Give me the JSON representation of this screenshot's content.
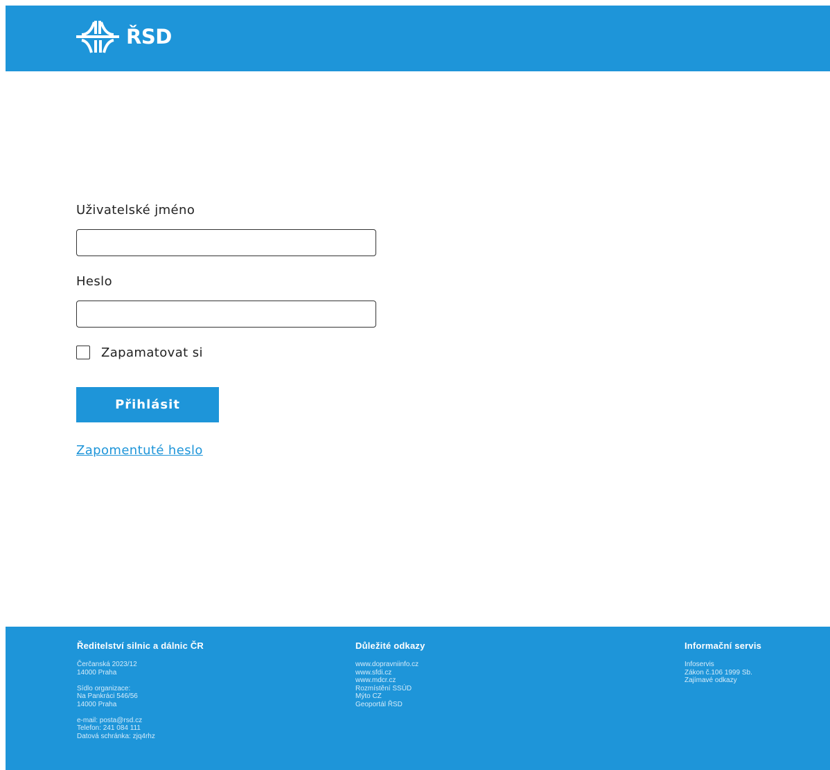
{
  "header": {
    "logo_text": "ŘSD",
    "logo_icon": "highway-interchange-icon",
    "background": "#1e95d9"
  },
  "login": {
    "username_label": "Uživatelské jméno",
    "username_value": "",
    "password_label": "Heslo",
    "password_value": "",
    "remember_label": "Zapamatovat si",
    "remember_checked": false,
    "submit_label": "Přihlásit",
    "forgot_label": "Zapomentuté heslo"
  },
  "footer": {
    "col1": {
      "title": "Ředitelství silnic a dálnic ČR",
      "address_line1": "Čerčanská 2023/12",
      "address_line2": "14000 Praha",
      "seat_label": "Sídlo organizace:",
      "seat_line1": "Na Pankráci 546/56",
      "seat_line2": "14000 Praha",
      "email": "e-mail: posta@rsd.cz",
      "phone": "Telefon: 241 084 111",
      "databox": "Datová schránka: zjq4rhz"
    },
    "col2": {
      "title": "Důležité odkazy",
      "links": [
        "www.dopravniinfo.cz",
        "www.sfdi.cz",
        "www.mdcr.cz",
        "Rozmístění SSÚD",
        "Mýto CZ",
        "Geoportál ŘSD"
      ]
    },
    "col3": {
      "title": "Informační servis",
      "links": [
        "Infoservis",
        "Zákon č.106 1999 Sb.",
        "Zajímavé odkazy"
      ]
    }
  },
  "colors": {
    "accent": "#1e95d9",
    "text": "#222222"
  }
}
